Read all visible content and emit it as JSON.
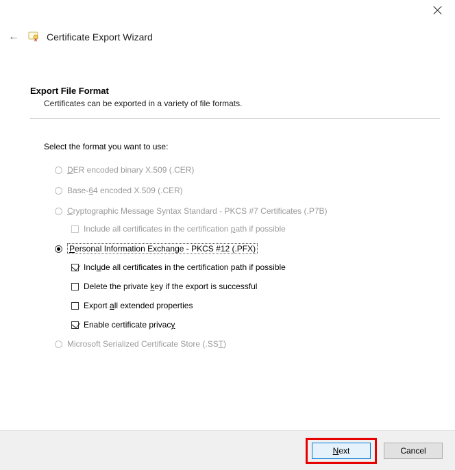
{
  "header": {
    "title": "Certificate Export Wizard"
  },
  "section": {
    "title": "Export File Format",
    "subtitle": "Certificates can be exported in a variety of file formats."
  },
  "prompt": "Select the format you want to use:",
  "options": {
    "der": {
      "prefix": "D",
      "rest": "ER encoded binary X.509 (.CER)"
    },
    "base64": {
      "prefix": "Base-",
      "u": "6",
      "rest": "4 encoded X.509 (.CER)"
    },
    "pkcs7": {
      "prefix": "C",
      "rest": "ryptographic Message Syntax Standard - PKCS #7 Certificates (.P7B)"
    },
    "pkcs7_include": {
      "pre": "Include all certificates in the certification ",
      "u": "p",
      "post": "ath if possible"
    },
    "pfx": {
      "prefix": "P",
      "rest": "ersonal Information Exchange - PKCS #12 (.PFX)"
    },
    "pfx_include": {
      "pre": "Incl",
      "u": "u",
      "post": "de all certificates in the certification path if possible"
    },
    "pfx_delete": {
      "pre": "Delete the private ",
      "u": "k",
      "post": "ey if the export is successful"
    },
    "pfx_ext": {
      "pre": "Export ",
      "u": "a",
      "post": "ll extended properties"
    },
    "pfx_privacy": {
      "pre": "Enable certificate privac",
      "u": "y",
      "post": ""
    },
    "sst": {
      "pre": "Microsoft Serialized Certificate Store (.SS",
      "u": "T",
      "post": ")"
    }
  },
  "footer": {
    "next": {
      "pre": "",
      "u": "N",
      "post": "ext"
    },
    "cancel": "Cancel"
  }
}
